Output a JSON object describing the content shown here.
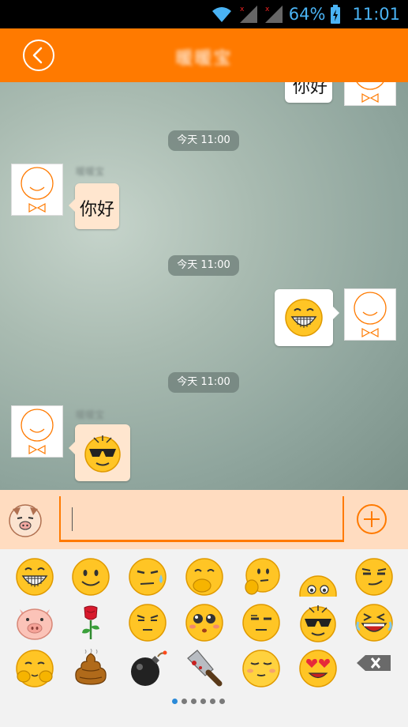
{
  "status_bar": {
    "battery_percent": "64%",
    "time": "11:01"
  },
  "header": {
    "title": "暖暖宝",
    "back_icon": "back-arrow-icon"
  },
  "chat": {
    "partial_top_message": "你好",
    "time_badges": [
      "今天 11:00",
      "今天 11:00",
      "今天 11:00"
    ],
    "messages": [
      {
        "from": "contact",
        "nickname": "暖暖宝",
        "text": "你好"
      },
      {
        "from": "me",
        "sticker": "big-grin-emoji"
      },
      {
        "from": "contact",
        "nickname": "暖暖宝",
        "sticker": "sunglasses-emoji"
      }
    ]
  },
  "input_bar": {
    "emoji_toggle_icon": "pig-face-icon",
    "input_value": "",
    "plus_icon": "plus-circle-icon"
  },
  "emoji_panel": {
    "rows": [
      [
        "big-grin",
        "smile",
        "sweat",
        "cover-laugh",
        "thinking",
        "peek",
        "smirk"
      ],
      [
        "pig",
        "rose",
        "annoyed",
        "blush",
        "meh",
        "cool",
        "laugh-tears"
      ],
      [
        "shy",
        "poop",
        "bomb",
        "knife",
        "relieved",
        "heart-eyes",
        "backspace"
      ]
    ],
    "page_count": 6,
    "active_page": 1
  },
  "colors": {
    "brand_orange": "#ff7a00",
    "bubble_in": "#ffe6cf",
    "accent_blue": "#4ab3f4"
  }
}
